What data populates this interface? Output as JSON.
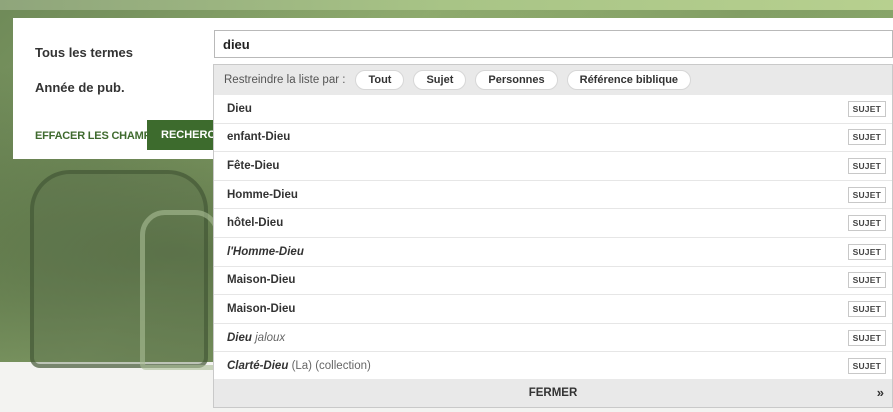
{
  "form": {
    "terms_label": "Tous les termes",
    "year_label": "Année de pub.",
    "clear_label": "EFFACER LES CHAMPS",
    "search_label": "RECHERCHER",
    "search_value": "dieu"
  },
  "dropdown": {
    "filter_label": "Restreindre la liste par :",
    "filters": [
      "Tout",
      "Sujet",
      "Personnes",
      "Référence biblique"
    ],
    "items": [
      {
        "term": "Dieu",
        "term_italic": false,
        "rest": "",
        "rest_italic": false,
        "type": "SUJET"
      },
      {
        "term": "enfant-Dieu",
        "term_italic": false,
        "rest": "",
        "rest_italic": false,
        "type": "SUJET"
      },
      {
        "term": "Fête-Dieu",
        "term_italic": false,
        "rest": "",
        "rest_italic": false,
        "type": "SUJET"
      },
      {
        "term": "Homme-Dieu",
        "term_italic": false,
        "rest": "",
        "rest_italic": false,
        "type": "SUJET"
      },
      {
        "term": "hôtel-Dieu",
        "term_italic": false,
        "rest": "",
        "rest_italic": false,
        "type": "SUJET"
      },
      {
        "term": "l'Homme-Dieu",
        "term_italic": true,
        "rest": "",
        "rest_italic": false,
        "type": "SUJET"
      },
      {
        "term": "Maison-Dieu",
        "term_italic": false,
        "rest": "",
        "rest_italic": false,
        "type": "SUJET"
      },
      {
        "term": "Maison-Dieu",
        "term_italic": false,
        "rest": "",
        "rest_italic": false,
        "type": "SUJET"
      },
      {
        "term": "Dieu",
        "term_italic": true,
        "rest": "jaloux",
        "rest_italic": true,
        "type": "SUJET"
      },
      {
        "term": "Clarté-Dieu",
        "term_italic": true,
        "rest": "(La) (collection)",
        "rest_italic": false,
        "type": "SUJET"
      }
    ],
    "close_label": "FERMER",
    "more_label": "»"
  },
  "colors": {
    "brand_green": "#3d6b2d",
    "link_green": "#3f6a2e"
  }
}
